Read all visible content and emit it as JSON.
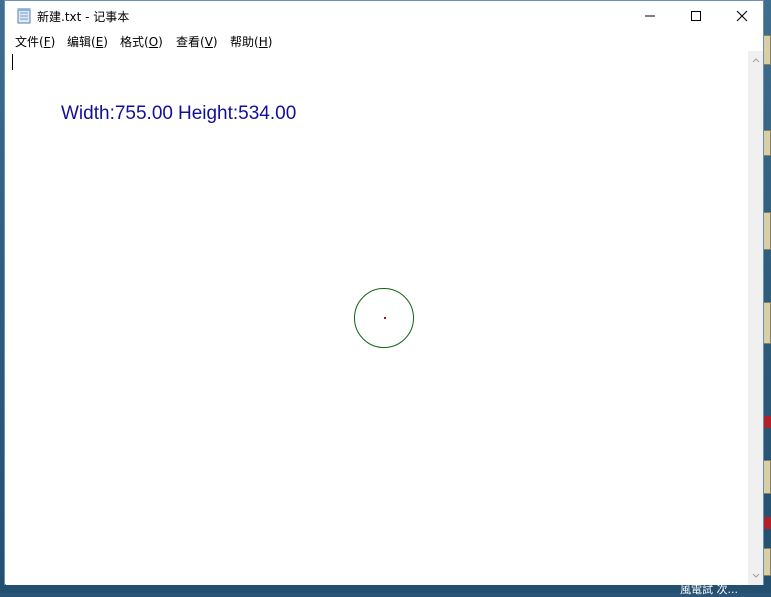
{
  "window": {
    "title": "新建.txt - 记事本",
    "menu": [
      {
        "label": "文件",
        "accel": "(F)",
        "key": "F"
      },
      {
        "label": "编辑",
        "accel": "(E)",
        "key": "E"
      },
      {
        "label": "格式",
        "accel": "(O)",
        "key": "O"
      },
      {
        "label": "查看",
        "accel": "(V)",
        "key": "V"
      },
      {
        "label": "帮助",
        "accel": "(H)",
        "key": "H"
      }
    ]
  },
  "overlay": {
    "width_label": "Width:755.00",
    "height_label": "Height:534.00",
    "color": "#12109a",
    "circle_color": "#0f6412",
    "center_color": "#b01010"
  },
  "desktop": {
    "partial_text": "風電試 次..."
  },
  "icons": [
    "notepad-icon",
    "minimize-icon",
    "maximize-icon",
    "close-icon",
    "scroll-up-icon",
    "scroll-down-icon"
  ]
}
